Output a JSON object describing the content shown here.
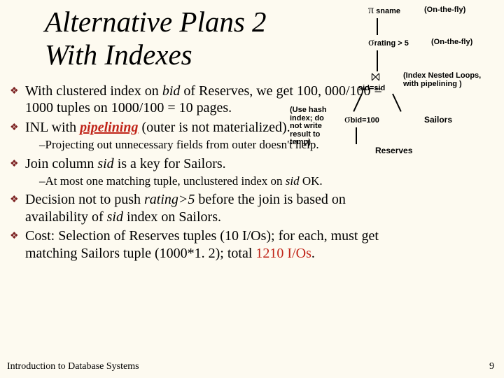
{
  "title_line1": "Alternative Plans 2",
  "title_line2": "With Indexes",
  "bullets": [
    {
      "prefix": "With clustered index on ",
      "ital1": "bid",
      "mid1": " of Reserves, we get 100, 000/100 =  1000 tuples on 1000/100 = 10 pages."
    },
    {
      "prefix": "INL with ",
      "ital_ul_red": "pipelining",
      "suffix": " (outer is not materialized)."
    }
  ],
  "sub1": "–Projecting out unnecessary fields from outer doesn't help.",
  "bullet3_pre": "Join column ",
  "bullet3_ital": "sid",
  "bullet3_post": " is a key for Sailors.",
  "sub2_pre": "–At most one matching tuple, unclustered index on ",
  "sub2_ital": "sid",
  "sub2_post": " OK.",
  "bullet4_pre": "Decision not to push ",
  "bullet4_ital": "rating>5",
  "bullet4_post": " before the join is based on availability of ",
  "bullet4_ital2": "sid",
  "bullet4_post2": " index on Sailors.",
  "bullet5_pre": "Cost:  Selection of Reserves tuples (10 I/Os); for each, must get matching Sailors tuple (1000*1. 2); total ",
  "bullet5_red": "1210 I/Os",
  "bullet5_post": ".",
  "footer": "Introduction to Database Systems",
  "page": "9",
  "diag": {
    "pi": "π",
    "sigma": "σ",
    "join": "⨝",
    "sname": "sname",
    "onthefly": "(On-the-fly)",
    "rating": "rating > 5",
    "onthefly2": "(On-the-fly)",
    "sidsid": "sid=sid",
    "inl_note1": "(Index Nested Loops,",
    "inl_note2": "with pipelining )",
    "hash_note": "(Use hash\nindex; do\nnot write\nresult to\ntemp)",
    "bid": "bid=100",
    "sailors": "Sailors",
    "reserves": "Reserves"
  }
}
